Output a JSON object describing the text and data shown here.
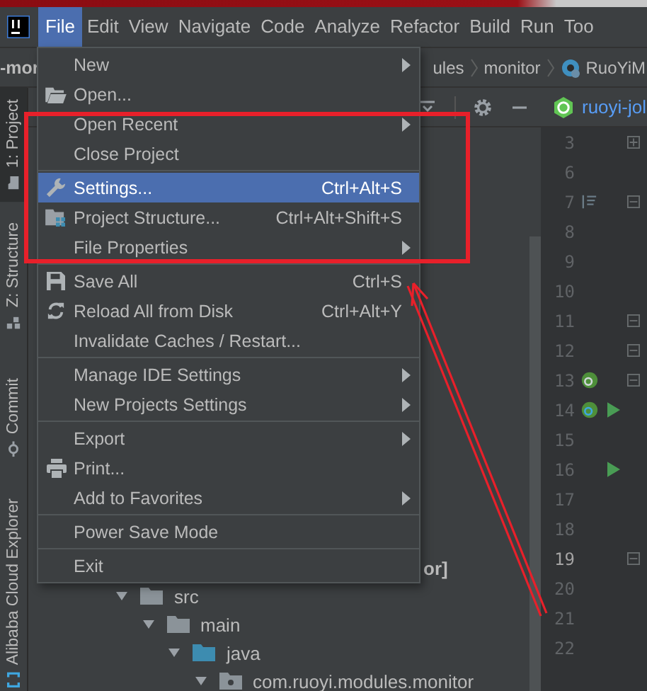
{
  "menubar": [
    {
      "label": "File",
      "selected": true
    },
    {
      "label": "Edit",
      "selected": false
    },
    {
      "label": "View",
      "selected": false
    },
    {
      "label": "Navigate",
      "selected": false
    },
    {
      "label": "Code",
      "selected": false
    },
    {
      "label": "Analyze",
      "selected": false
    },
    {
      "label": "Refactor",
      "selected": false
    },
    {
      "label": "Build",
      "selected": false
    },
    {
      "label": "Run",
      "selected": false
    },
    {
      "label": "Too",
      "selected": false
    }
  ],
  "navigation": {
    "project": "-mor",
    "path": [
      "ules",
      "monitor",
      "RuoYiM"
    ]
  },
  "left_tool_windows": [
    {
      "label": "1: Project",
      "selected": true
    },
    {
      "label": "Z: Structure",
      "selected": false
    },
    {
      "label": "Commit",
      "selected": false
    },
    {
      "label": "Alibaba Cloud Explorer",
      "selected": false
    }
  ],
  "file_menu": [
    {
      "kind": "item",
      "label": "New",
      "submenu": true,
      "selected": false
    },
    {
      "kind": "item",
      "label": "Open...",
      "submenu": false,
      "selected": false
    },
    {
      "kind": "item",
      "label": "Open Recent",
      "submenu": true,
      "selected": false
    },
    {
      "kind": "item",
      "label": "Close Project",
      "submenu": false,
      "selected": false
    },
    {
      "kind": "separator"
    },
    {
      "kind": "item",
      "label": "Settings...",
      "shortcut": "Ctrl+Alt+S",
      "submenu": false,
      "selected": true
    },
    {
      "kind": "item",
      "label": "Project Structure...",
      "shortcut": "Ctrl+Alt+Shift+S",
      "submenu": false,
      "selected": false
    },
    {
      "kind": "item",
      "label": "File Properties",
      "submenu": true,
      "selected": false
    },
    {
      "kind": "separator"
    },
    {
      "kind": "item",
      "label": "Save All",
      "shortcut": "Ctrl+S",
      "submenu": false,
      "selected": false
    },
    {
      "kind": "item",
      "label": "Reload All from Disk",
      "shortcut": "Ctrl+Alt+Y",
      "submenu": false,
      "selected": false
    },
    {
      "kind": "item",
      "label": "Invalidate Caches / Restart...",
      "submenu": false,
      "selected": false
    },
    {
      "kind": "separator"
    },
    {
      "kind": "item",
      "label": "Manage IDE Settings",
      "submenu": true,
      "selected": false
    },
    {
      "kind": "item",
      "label": "New Projects Settings",
      "submenu": true,
      "selected": false
    },
    {
      "kind": "separator"
    },
    {
      "kind": "item",
      "label": "Export",
      "submenu": true,
      "selected": false
    },
    {
      "kind": "item",
      "label": "Print...",
      "submenu": false,
      "selected": false
    },
    {
      "kind": "item",
      "label": "Add to Favorites",
      "submenu": true,
      "selected": false
    },
    {
      "kind": "separator"
    },
    {
      "kind": "item",
      "label": "Power Save Mode",
      "submenu": false,
      "selected": false
    },
    {
      "kind": "separator"
    },
    {
      "kind": "item",
      "label": "Exit",
      "submenu": false,
      "selected": false
    }
  ],
  "project_tree": {
    "partial_label": "or]",
    "items": [
      {
        "label": "src",
        "kind": "folder",
        "expanded": true,
        "children": [
          {
            "label": "main",
            "kind": "folder",
            "expanded": true,
            "children": [
              {
                "label": "java",
                "kind": "source-folder",
                "expanded": true,
                "children": [
                  {
                    "label": "com.ruoyi.modules.monitor",
                    "kind": "package",
                    "expanded": true
                  }
                ]
              }
            ]
          }
        ]
      }
    ]
  },
  "editor": {
    "tab": "ruoyi-jol",
    "lines": [
      {
        "number": "3",
        "current": false
      },
      {
        "number": "6",
        "current": false
      },
      {
        "number": "7",
        "current": false
      },
      {
        "number": "8",
        "current": false
      },
      {
        "number": "9",
        "current": false
      },
      {
        "number": "10",
        "current": false
      },
      {
        "number": "11",
        "current": false
      },
      {
        "number": "12",
        "current": false
      },
      {
        "number": "13",
        "current": false
      },
      {
        "number": "14",
        "current": false
      },
      {
        "number": "15",
        "current": false
      },
      {
        "number": "16",
        "current": false
      },
      {
        "number": "17",
        "current": false
      },
      {
        "number": "18",
        "current": false
      },
      {
        "number": "19",
        "current": true
      },
      {
        "number": "20",
        "current": false
      },
      {
        "number": "21",
        "current": false
      },
      {
        "number": "22",
        "current": false
      }
    ]
  }
}
